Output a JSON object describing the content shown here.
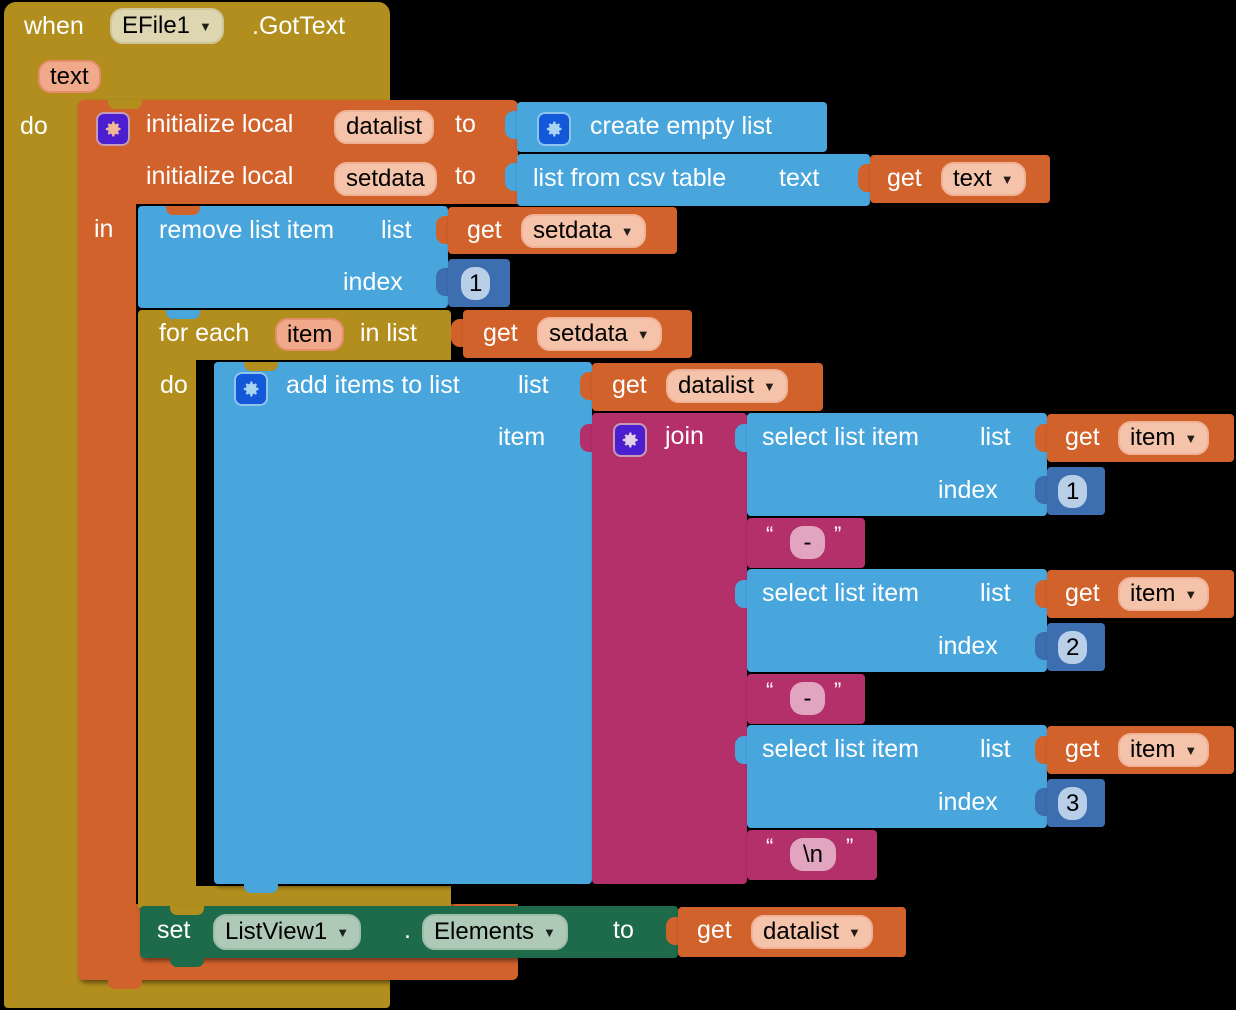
{
  "app": "MIT App Inventor blocks editor",
  "blocks": {
    "event": {
      "when_label": "when",
      "component": "EFile1",
      "method": ".GotText",
      "param": "text",
      "do_label": "do"
    },
    "init_local_1": {
      "label": "initialize local",
      "name": "datalist",
      "to_label": "to",
      "gear": "mutator-gear-icon"
    },
    "create_empty_list": {
      "label": "create empty list",
      "gear": "mutator-gear-icon"
    },
    "init_local_2": {
      "label": "initialize local",
      "name": "setdata",
      "to_label": "to"
    },
    "list_from_csv": {
      "label": "list from csv table",
      "socket_label": "text"
    },
    "get_text": {
      "get_label": "get",
      "var": "text"
    },
    "in_label": "in",
    "remove_list_item": {
      "label": "remove list item",
      "list_label": "list",
      "index_label": "index",
      "index_value": "1"
    },
    "get_setdata_1": {
      "get_label": "get",
      "var": "setdata"
    },
    "for_each": {
      "label": "for each",
      "var": "item",
      "in_list_label": "in list",
      "do_label": "do"
    },
    "get_setdata_2": {
      "get_label": "get",
      "var": "setdata"
    },
    "add_items_to_list": {
      "label": "add items to list",
      "list_label": "list",
      "item_label": "item",
      "gear": "mutator-gear-icon"
    },
    "get_datalist_1": {
      "get_label": "get",
      "var": "datalist"
    },
    "join": {
      "label": "join",
      "gear": "mutator-gear-icon"
    },
    "join_args": [
      {
        "kind": "select_list_item",
        "label": "select list item",
        "list_label": "list",
        "index_label": "index",
        "index_value": "1",
        "get_label": "get",
        "get_var": "item"
      },
      {
        "kind": "text",
        "open_quote": "“",
        "value": "-",
        "close_quote": "”"
      },
      {
        "kind": "select_list_item",
        "label": "select list item",
        "list_label": "list",
        "index_label": "index",
        "index_value": "2",
        "get_label": "get",
        "get_var": "item"
      },
      {
        "kind": "text",
        "open_quote": "“",
        "value": "-",
        "close_quote": "”"
      },
      {
        "kind": "select_list_item",
        "label": "select list item",
        "list_label": "list",
        "index_label": "index",
        "index_value": "3",
        "get_label": "get",
        "get_var": "item"
      },
      {
        "kind": "text",
        "open_quote": "“",
        "value": "\\n",
        "close_quote": "”"
      }
    ],
    "set_listview": {
      "set_label": "set",
      "component": "ListView1",
      "dot": ".",
      "property": "Elements",
      "to_label": "to"
    },
    "get_datalist_2": {
      "get_label": "get",
      "var": "datalist"
    }
  },
  "colors": {
    "event": "#b18e1e",
    "control": "#b18e1e",
    "variables": "#d2622c",
    "lists": "#49a6dc",
    "text": "#b4306a",
    "math": "#3d6eb0",
    "setter": "#1d6b4a",
    "canvas": "#000000"
  }
}
